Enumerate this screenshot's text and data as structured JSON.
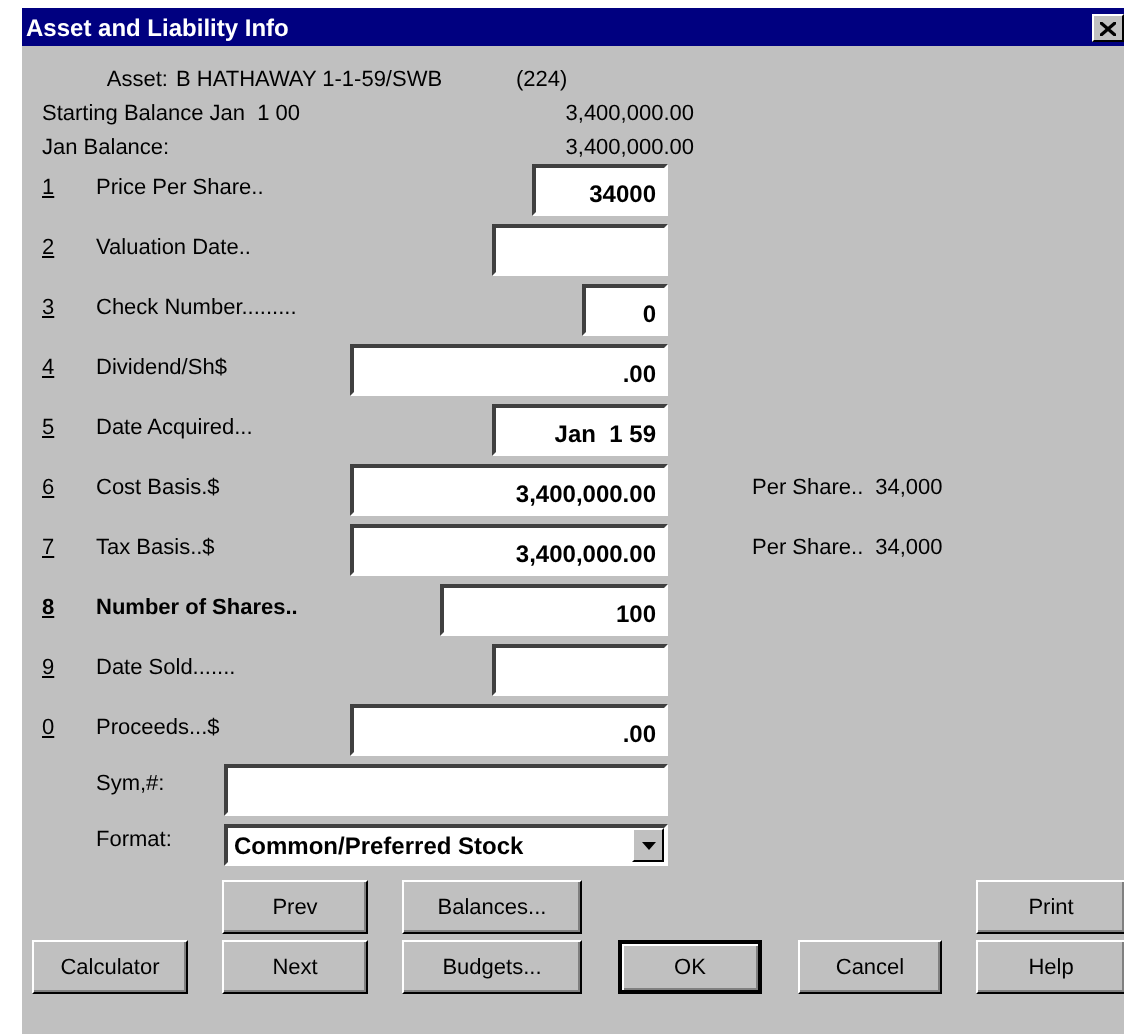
{
  "window": {
    "title": "Asset and Liability Info"
  },
  "asset": {
    "label": "Asset:",
    "name": "B HATHAWAY 1-1-59/SWB",
    "number": "(224)"
  },
  "balances": [
    {
      "label": "Starting Balance Jan  1 00",
      "value": "3,400,000.00"
    },
    {
      "label": "Jan Balance:",
      "value": "3,400,000.00"
    }
  ],
  "fields": [
    {
      "key": "1",
      "label": "Price Per Share..",
      "value": "34000",
      "emphasized": false
    },
    {
      "key": "2",
      "label": "Valuation Date..",
      "emphasized": false
    },
    {
      "key": "3",
      "label": "Check Number.........",
      "value": "0",
      "emphasized": false
    },
    {
      "key": "4",
      "label": "Dividend/Sh$",
      "value": ".00",
      "emphasized": false
    },
    {
      "key": "5",
      "label": "Date Acquired...",
      "value": "Jan  1 59",
      "emphasized": false
    },
    {
      "key": "6",
      "label": "Cost Basis.$",
      "value": "3,400,000.00",
      "emphasized": false,
      "note": {
        "label": "Per Share..",
        "value": "34,000"
      }
    },
    {
      "key": "7",
      "label": "Tax Basis..$",
      "value": "3,400,000.00",
      "emphasized": false,
      "note": {
        "label": "Per Share..",
        "value": "34,000"
      }
    },
    {
      "key": "8",
      "label": "Number of Shares..",
      "value": "100",
      "emphasized": true
    },
    {
      "key": "9",
      "label": "Date Sold.......",
      "emphasized": false
    },
    {
      "key": "0",
      "label": "Proceeds...$",
      "value": ".00",
      "emphasized": false
    }
  ],
  "symbol": {
    "label": "Sym,#:"
  },
  "format": {
    "label": "Format:",
    "value": "Common/Preferred Stock"
  },
  "buttons": [
    {
      "label": "Prev",
      "default": false
    },
    {
      "label": "Balances...",
      "default": false
    },
    {
      "label": "Print",
      "default": false
    },
    {
      "label": "Calculator",
      "default": false
    },
    {
      "label": "Next",
      "default": false
    },
    {
      "label": "Budgets...",
      "default": false
    },
    {
      "label": "OK",
      "default": true
    },
    {
      "label": "Cancel",
      "default": false
    },
    {
      "label": "Help",
      "default": false
    }
  ]
}
